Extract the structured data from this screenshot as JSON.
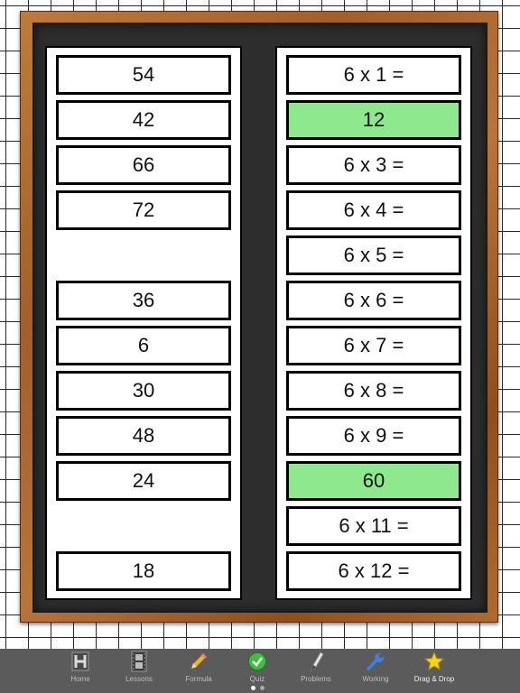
{
  "left_column": [
    "54",
    "42",
    "66",
    "72",
    "",
    "36",
    "6",
    "30",
    "48",
    "24",
    "",
    "18"
  ],
  "right_column": [
    {
      "text": "6 x 1 =",
      "correct": false
    },
    {
      "text": "12",
      "correct": true
    },
    {
      "text": "6 x 3 =",
      "correct": false
    },
    {
      "text": "6 x 4 =",
      "correct": false
    },
    {
      "text": "6 x 5 =",
      "correct": false
    },
    {
      "text": "6 x 6 =",
      "correct": false
    },
    {
      "text": "6 x 7 =",
      "correct": false
    },
    {
      "text": "6 x 8 =",
      "correct": false
    },
    {
      "text": "6 x 9 =",
      "correct": false
    },
    {
      "text": "60",
      "correct": true
    },
    {
      "text": "6 x 11 =",
      "correct": false
    },
    {
      "text": "6 x 12 =",
      "correct": false
    }
  ],
  "colors": {
    "correct": "#8ee88e",
    "tabbar": "#5b5b5b"
  },
  "tabs": [
    {
      "label": "Home",
      "icon": "home-icon"
    },
    {
      "label": "Lessons",
      "icon": "film-icon"
    },
    {
      "label": "Formula",
      "icon": "pencil-icon"
    },
    {
      "label": "Quiz",
      "icon": "checkmark-icon"
    },
    {
      "label": "Problems",
      "icon": "pen-icon"
    },
    {
      "label": "Working",
      "icon": "wrench-icon"
    },
    {
      "label": "Drag & Drop",
      "icon": "star-icon",
      "active": true
    }
  ],
  "page_indicator": {
    "pages": 2,
    "current": 1
  }
}
